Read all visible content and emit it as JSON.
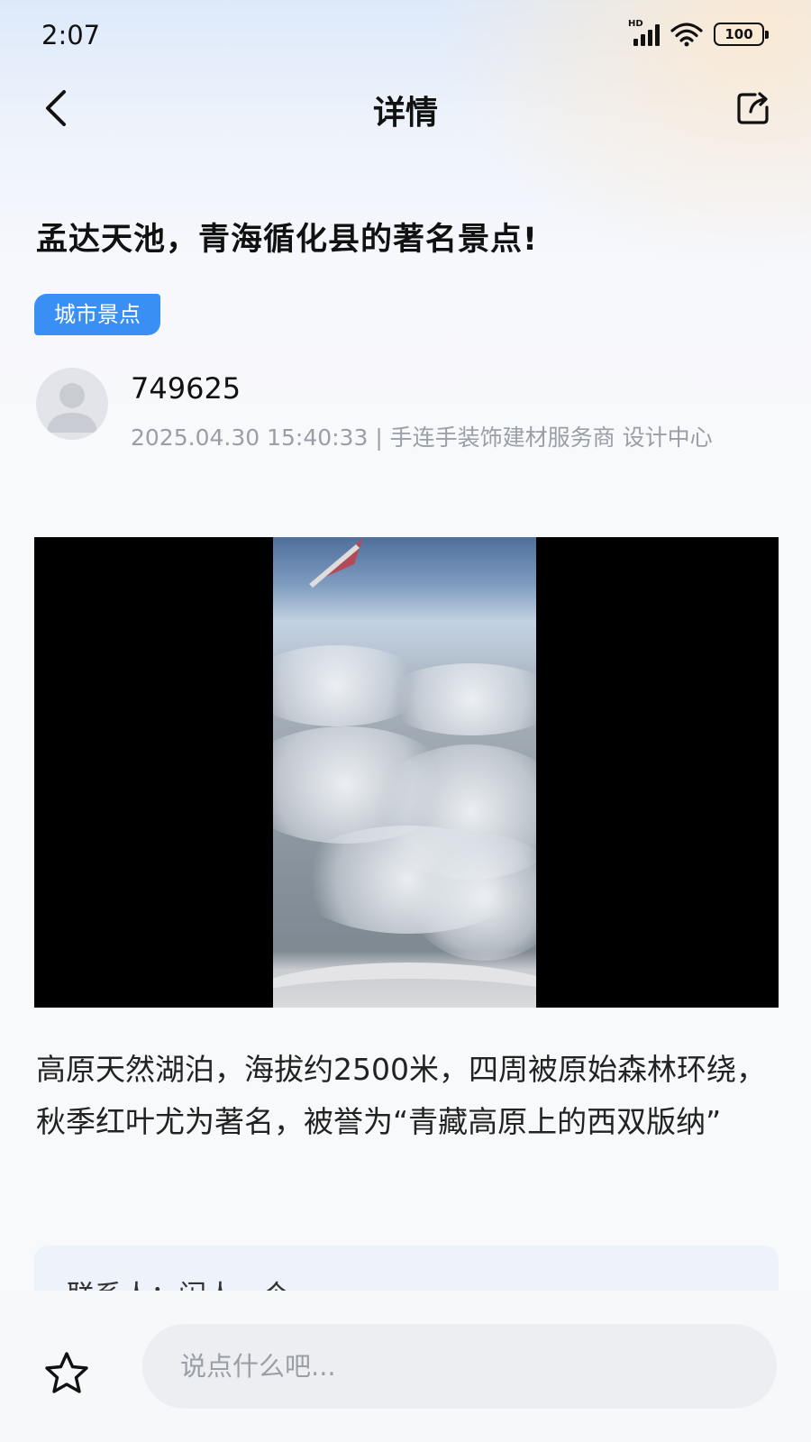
{
  "status_bar": {
    "time": "2:07",
    "network": "HD",
    "battery": "100"
  },
  "nav": {
    "title": "详情",
    "back_icon": "chevron-left-icon",
    "share_icon": "share-icon"
  },
  "post": {
    "title": "孟达天池，青海循化县的著名景点!",
    "tag": "城市景点",
    "author": {
      "name": "749625",
      "meta": "2025.04.30 15:40:33 | 手连手装饰建材服务商 设计中心"
    },
    "media": {
      "type": "video",
      "description_icon": "video-thumbnail"
    },
    "content": "高原天然湖泊，海拔约2500米，四周被原始森林环绕，秋季红叶尤为著名，被誉为“青藏高原上的西双版纳”",
    "contact": "联系人：闲人一个"
  },
  "bottom_bar": {
    "favorite_icon": "star-icon",
    "comment_placeholder": "说点什么吧..."
  },
  "colors": {
    "accent": "#3a8ff4",
    "meta_text": "#9a9ea6",
    "card_bg": "#eef2fb"
  }
}
